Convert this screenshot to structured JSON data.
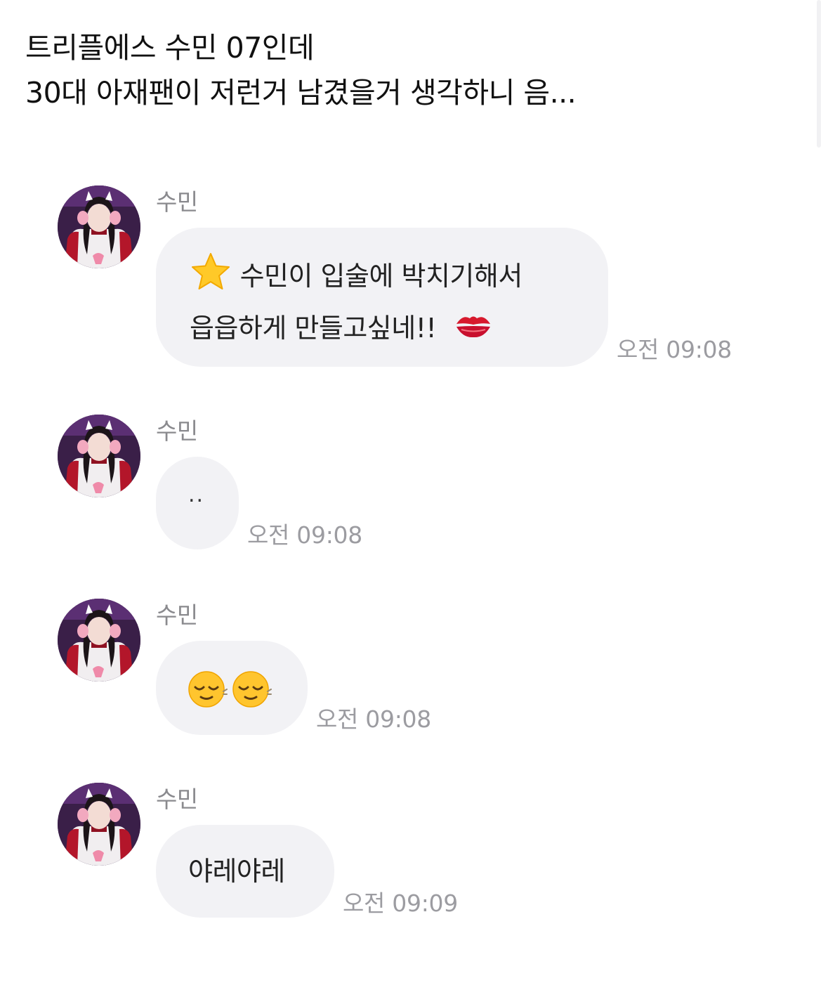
{
  "post": {
    "line1": "트리플에스 수민 07인데",
    "line2": "30대 아재팬이 저런거 남겼을거 생각하니 음..."
  },
  "chat": {
    "messages": [
      {
        "sender": "수민",
        "line1": "수민이 입술에 박치기해서",
        "line2": "읍읍하게 만들고싶네!!",
        "time": "오전 09:08",
        "emojis": [
          "star-emoji",
          "kiss-mark-emoji"
        ]
      },
      {
        "sender": "수민",
        "text": "..",
        "time": "오전 09:08"
      },
      {
        "sender": "수민",
        "time": "오전 09:08",
        "emojis": [
          "relieved-face-emoji",
          "relieved-face-emoji"
        ]
      },
      {
        "sender": "수민",
        "text": "야레야레",
        "time": "오전 09:09"
      }
    ]
  },
  "colors": {
    "bubble": "#f2f2f5",
    "time": "#9c9ca1",
    "sender": "#8a8a8e"
  }
}
